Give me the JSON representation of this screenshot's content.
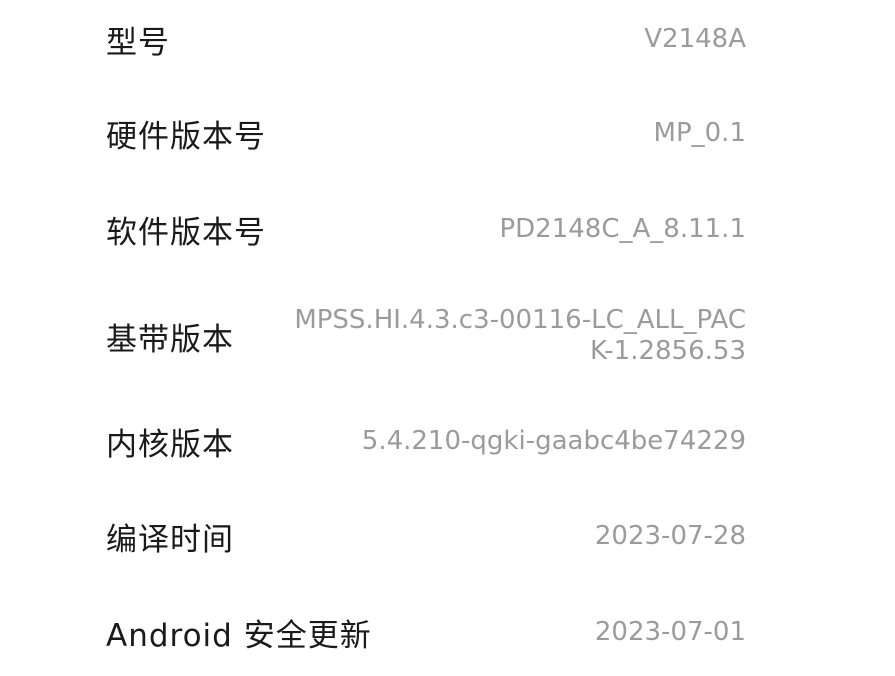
{
  "about_phone": {
    "rows": [
      {
        "label": "型号",
        "value": "V2148A"
      },
      {
        "label": "硬件版本号",
        "value": "MP_0.1"
      },
      {
        "label": "软件版本号",
        "value": "PD2148C_A_8.11.1"
      },
      {
        "label": "基带版本",
        "value": "MPSS.HI.4.3.c3-00116-LC_ALL_PACK-1.2856.53"
      },
      {
        "label": "内核版本",
        "value": "5.4.210-qgki-gaabc4be74229"
      },
      {
        "label": "编译时间",
        "value": "2023-07-28"
      },
      {
        "label": "Android 安全更新",
        "value": "2023-07-01"
      }
    ]
  }
}
